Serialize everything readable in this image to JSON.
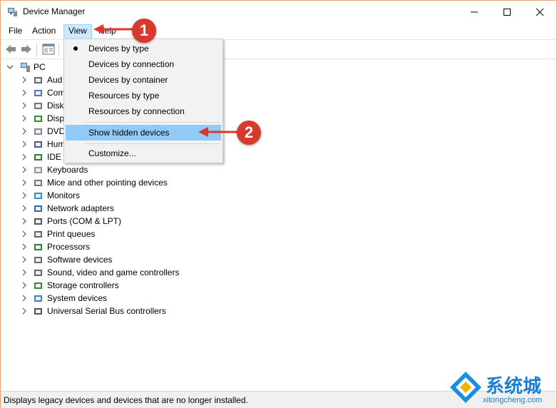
{
  "window": {
    "title": "Device Manager"
  },
  "menubar": {
    "items": [
      "File",
      "Action",
      "View",
      "Help"
    ]
  },
  "tree": {
    "root": "PC",
    "items": [
      {
        "label": "Aud",
        "icon": "speaker-icon"
      },
      {
        "label": "Com",
        "icon": "computer-icon"
      },
      {
        "label": "Disk",
        "icon": "disk-drive-icon"
      },
      {
        "label": "Disp",
        "icon": "display-adapter-icon"
      },
      {
        "label": "DVD",
        "icon": "dvd-drive-icon"
      },
      {
        "label": "Hum",
        "icon": "hid-icon"
      },
      {
        "label": "IDE A",
        "icon": "ide-controller-icon"
      },
      {
        "label": "Keyboards",
        "icon": "keyboard-icon"
      },
      {
        "label": "Mice and other pointing devices",
        "icon": "mouse-icon"
      },
      {
        "label": "Monitors",
        "icon": "monitor-icon"
      },
      {
        "label": "Network adapters",
        "icon": "network-adapter-icon"
      },
      {
        "label": "Ports (COM & LPT)",
        "icon": "port-icon"
      },
      {
        "label": "Print queues",
        "icon": "printer-icon"
      },
      {
        "label": "Processors",
        "icon": "processor-icon"
      },
      {
        "label": "Software devices",
        "icon": "software-device-icon"
      },
      {
        "label": "Sound, video and game controllers",
        "icon": "sound-icon"
      },
      {
        "label": "Storage controllers",
        "icon": "storage-controller-icon"
      },
      {
        "label": "System devices",
        "icon": "system-device-icon"
      },
      {
        "label": "Universal Serial Bus controllers",
        "icon": "usb-icon"
      }
    ]
  },
  "view_menu": {
    "items": [
      {
        "label": "Devices by type",
        "checked": true
      },
      {
        "label": "Devices by connection"
      },
      {
        "label": "Devices by container"
      },
      {
        "label": "Resources by type"
      },
      {
        "label": "Resources by connection"
      },
      {
        "label": "Show hidden devices",
        "highlighted": true
      },
      {
        "label": "Customize..."
      }
    ]
  },
  "callouts": [
    "1",
    "2"
  ],
  "status": {
    "text": "Displays legacy devices and devices that are no longer installed."
  },
  "watermark": {
    "text": "系统城",
    "url": "xitongcheng.com"
  },
  "colors": {
    "highlight": "#91c9f7",
    "menu_active": "#cce8ff",
    "callout": "#d73a2c",
    "watermark": "#1a7fd0"
  }
}
